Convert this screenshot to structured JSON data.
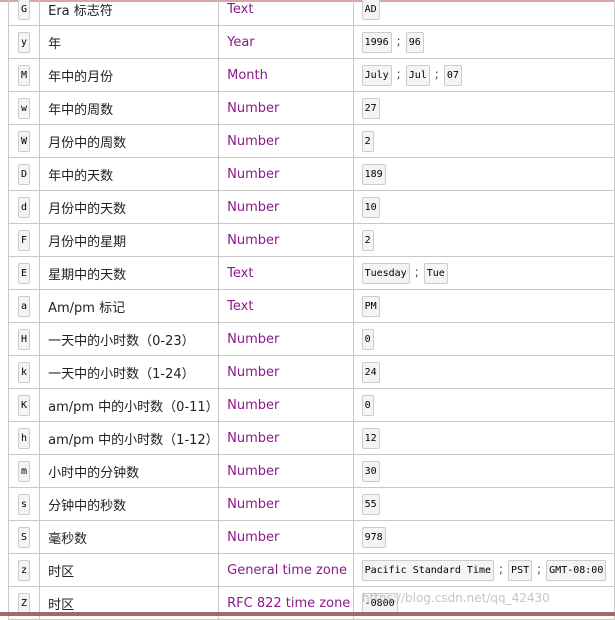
{
  "rows": [
    {
      "letter": "G",
      "desc": "Era 标志符",
      "type": "Text",
      "examples": [
        "AD"
      ]
    },
    {
      "letter": "y",
      "desc": "年",
      "type": "Year",
      "examples": [
        "1996",
        "96"
      ]
    },
    {
      "letter": "M",
      "desc": "年中的月份",
      "type": "Month",
      "examples": [
        "July",
        "Jul",
        "07"
      ]
    },
    {
      "letter": "w",
      "desc": "年中的周数",
      "type": "Number",
      "examples": [
        "27"
      ]
    },
    {
      "letter": "W",
      "desc": "月份中的周数",
      "type": "Number",
      "examples": [
        "2"
      ]
    },
    {
      "letter": "D",
      "desc": "年中的天数",
      "type": "Number",
      "examples": [
        "189"
      ]
    },
    {
      "letter": "d",
      "desc": "月份中的天数",
      "type": "Number",
      "examples": [
        "10"
      ]
    },
    {
      "letter": "F",
      "desc": "月份中的星期",
      "type": "Number",
      "examples": [
        "2"
      ]
    },
    {
      "letter": "E",
      "desc": "星期中的天数",
      "type": "Text",
      "examples": [
        "Tuesday",
        "Tue"
      ]
    },
    {
      "letter": "a",
      "desc": "Am/pm 标记",
      "type": "Text",
      "examples": [
        "PM"
      ]
    },
    {
      "letter": "H",
      "desc": "一天中的小时数（0-23）",
      "type": "Number",
      "examples": [
        "0"
      ]
    },
    {
      "letter": "k",
      "desc": "一天中的小时数（1-24）",
      "type": "Number",
      "examples": [
        "24"
      ]
    },
    {
      "letter": "K",
      "desc": "am/pm 中的小时数（0-11）",
      "type": "Number",
      "examples": [
        "0"
      ]
    },
    {
      "letter": "h",
      "desc": "am/pm 中的小时数（1-12）",
      "type": "Number",
      "examples": [
        "12"
      ]
    },
    {
      "letter": "m",
      "desc": "小时中的分钟数",
      "type": "Number",
      "examples": [
        "30"
      ]
    },
    {
      "letter": "s",
      "desc": "分钟中的秒数",
      "type": "Number",
      "examples": [
        "55"
      ]
    },
    {
      "letter": "S",
      "desc": "毫秒数",
      "type": "Number",
      "examples": [
        "978"
      ]
    },
    {
      "letter": "z",
      "desc": "时区",
      "type": "General time zone",
      "examples": [
        "Pacific Standard Time",
        "PST",
        "GMT-08:00"
      ]
    },
    {
      "letter": "Z",
      "desc": "时区",
      "type": "RFC 822 time zone",
      "examples": [
        "-0800"
      ]
    }
  ],
  "separator": ";",
  "watermark": "https://blog.csdn.net/qq_42430"
}
